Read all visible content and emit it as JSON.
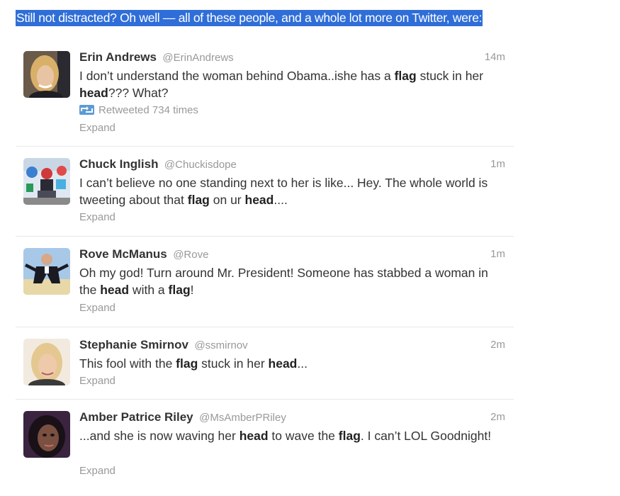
{
  "headline": "Still not distracted? Oh well — all of these people, and a whole lot more on Twitter, were:",
  "tweets": [
    {
      "fullname": "Erin Andrews",
      "username": "@ErinAndrews",
      "time": "14m",
      "text": [
        {
          "t": "I don’t understand the woman behind Obama..ishe has a "
        },
        {
          "t": "flag",
          "b": true
        },
        {
          "t": " stuck in her "
        },
        {
          "t": "head",
          "b": true
        },
        {
          "t": "??? What?"
        }
      ],
      "retweeted": "Retweeted 734 times",
      "expand": "Expand"
    },
    {
      "fullname": "Chuck Inglish",
      "username": "@Chuckisdope",
      "time": "1m",
      "text": [
        {
          "t": "I can’t believe no one standing next to her is like... Hey. The whole world is tweeting about that "
        },
        {
          "t": "flag",
          "b": true
        },
        {
          "t": " on ur "
        },
        {
          "t": "head",
          "b": true
        },
        {
          "t": "...."
        }
      ],
      "expand": "Expand"
    },
    {
      "fullname": "Rove McManus",
      "username": "@Rove",
      "time": "1m",
      "text": [
        {
          "t": "Oh my god! Turn around Mr. President! Someone has stabbed a woman in the "
        },
        {
          "t": "head",
          "b": true
        },
        {
          "t": " with a "
        },
        {
          "t": "flag",
          "b": true
        },
        {
          "t": "!"
        }
      ],
      "expand": "Expand"
    },
    {
      "fullname": "Stephanie Smirnov",
      "username": "@ssmirnov",
      "time": "2m",
      "text": [
        {
          "t": "This fool with the "
        },
        {
          "t": "flag",
          "b": true
        },
        {
          "t": " stuck in her "
        },
        {
          "t": "head",
          "b": true
        },
        {
          "t": "..."
        }
      ],
      "expand": "Expand"
    },
    {
      "fullname": "Amber Patrice Riley",
      "username": "@MsAmberPRiley",
      "time": "2m",
      "text": [
        {
          "t": "...and she is now waving her "
        },
        {
          "t": "head",
          "b": true
        },
        {
          "t": " to wave the "
        },
        {
          "t": "flag",
          "b": true
        },
        {
          "t": ". I can’t LOL Goodnight!"
        }
      ],
      "expand": "Expand"
    }
  ]
}
